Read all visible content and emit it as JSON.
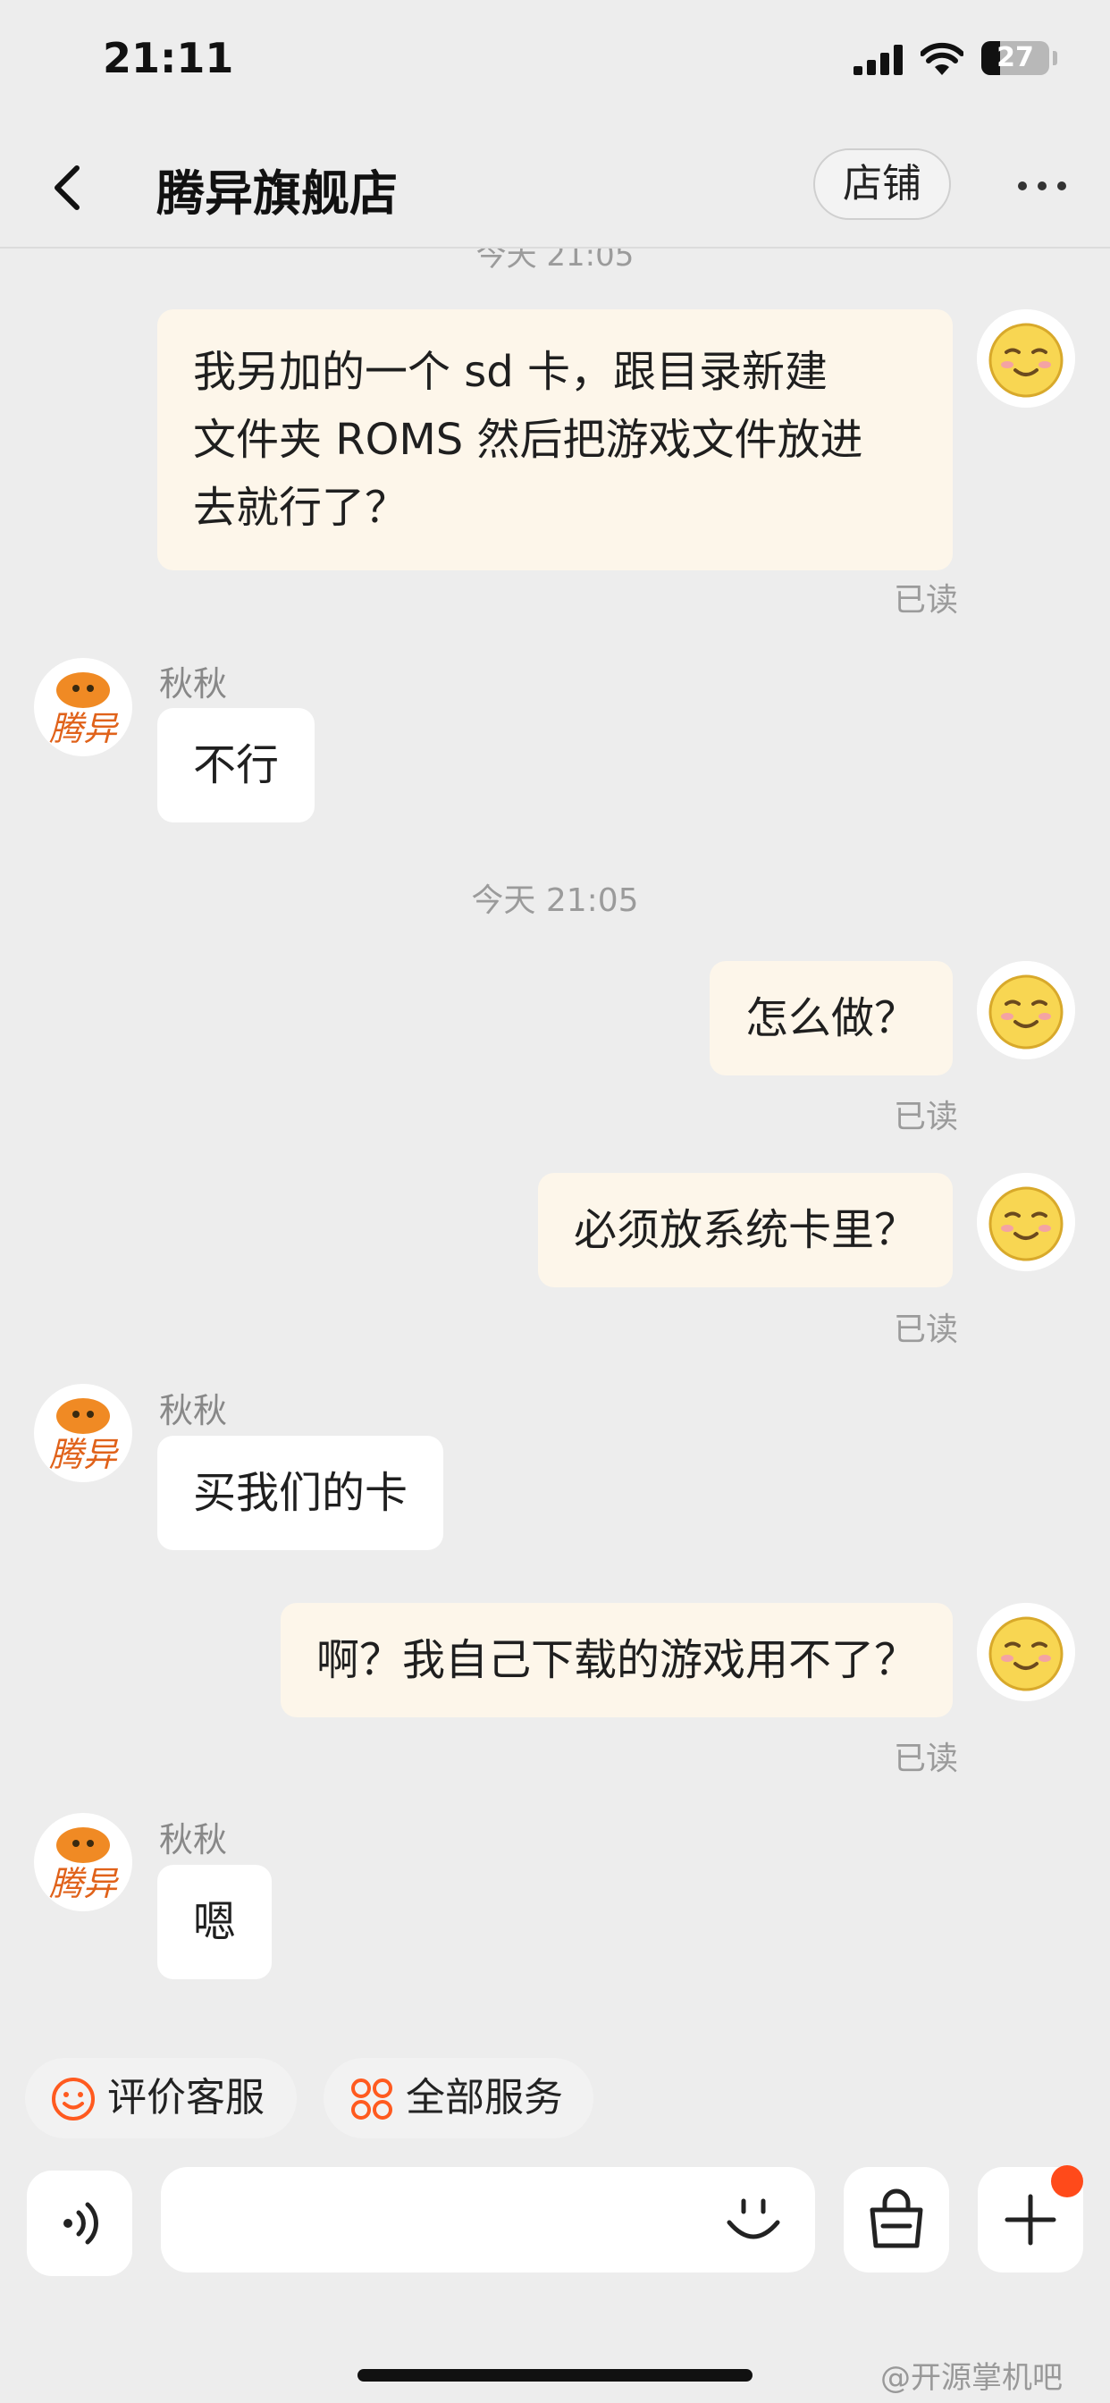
{
  "status_bar": {
    "time": "21:11",
    "battery": "27"
  },
  "header": {
    "back_icon": "chevron-left-icon",
    "title": "腾异旗舰店",
    "store_button": "店铺",
    "more_icon": "more-icon"
  },
  "chat": {
    "clipped_timestamp": "今天 21:05",
    "messages": [
      {
        "side": "out",
        "text_lines": [
          "我另加的一个 sd 卡，跟目录新建",
          "文件夹 ROMS 然后把游戏文件放进",
          "去就行了？"
        ],
        "read": "已读"
      },
      {
        "side": "in",
        "sender": "秋秋",
        "avatar_text": "腾异",
        "text": "不行"
      },
      {
        "type": "time",
        "text": "今天 21:05"
      },
      {
        "side": "out",
        "text": "怎么做？",
        "read": "已读"
      },
      {
        "side": "out",
        "text": "必须放系统卡里？",
        "read": "已读"
      },
      {
        "side": "in",
        "sender": "秋秋",
        "avatar_text": "腾异",
        "text": "买我们的卡"
      },
      {
        "side": "out",
        "text": "啊？我自己下载的游戏用不了？",
        "read": "已读"
      },
      {
        "side": "in",
        "sender": "秋秋",
        "avatar_text": "腾异",
        "text": "嗯"
      }
    ]
  },
  "quick_actions": [
    {
      "icon": "smile-icon",
      "label": "评价客服"
    },
    {
      "icon": "grid-icon",
      "label": "全部服务"
    }
  ],
  "input_bar": {
    "voice_icon": "voice-icon",
    "placeholder": "",
    "emoji_icon": "emoji-icon",
    "bag_icon": "shopping-bag-icon",
    "plus_icon": "plus-icon"
  },
  "watermark": "@开源掌机吧",
  "colors": {
    "background": "#ededed",
    "outgoing_bubble": "#fdf6ea",
    "incoming_bubble": "#ffffff",
    "accent": "#ff4a1a",
    "shop_avatar": "#f08a24"
  }
}
